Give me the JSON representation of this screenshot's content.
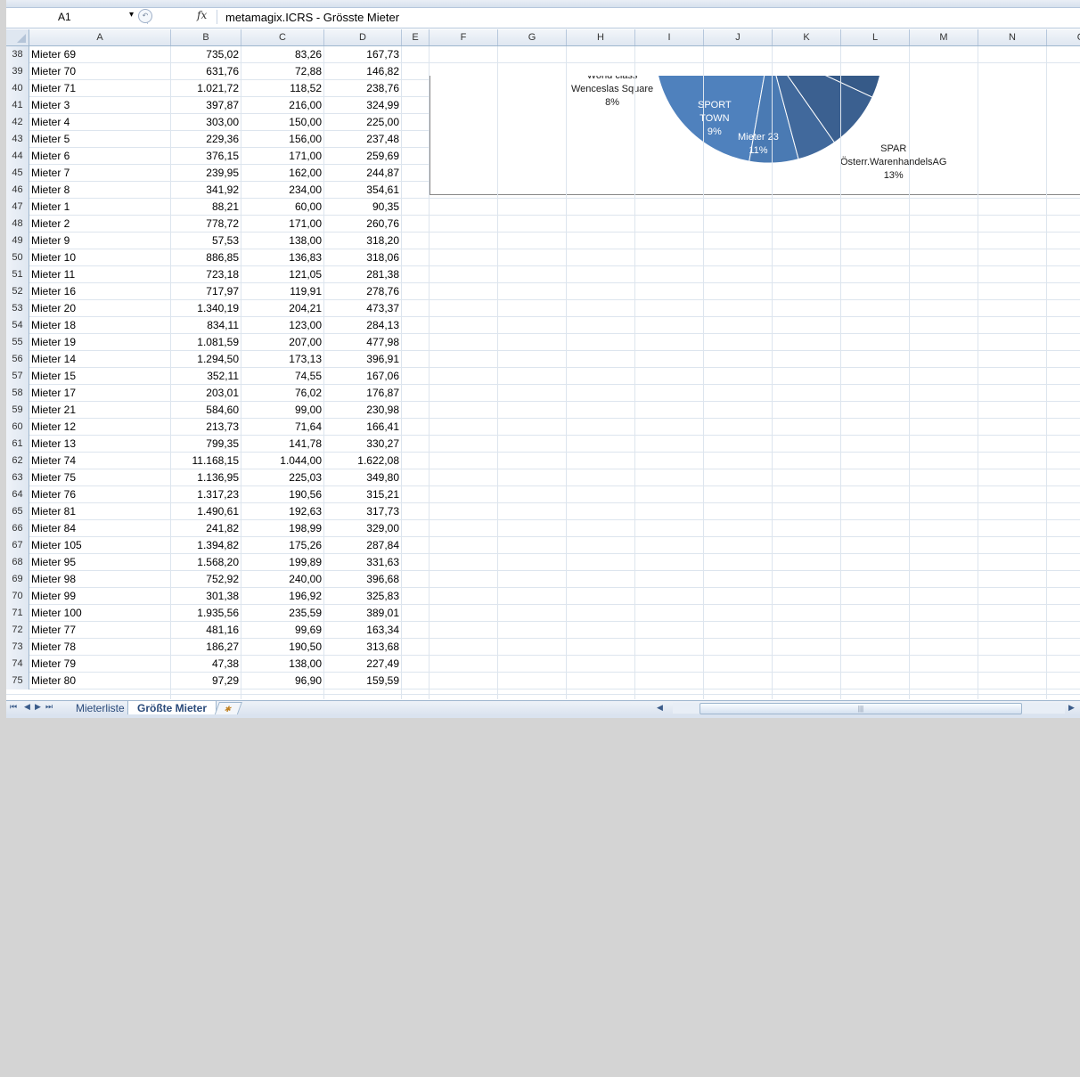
{
  "formula_bar": {
    "name_box": "A1",
    "fx_label": "fx",
    "formula": "metamagix.ICRS - Grösste Mieter"
  },
  "columns": [
    "A",
    "B",
    "C",
    "D",
    "E",
    "F",
    "G",
    "H",
    "I",
    "J",
    "K",
    "L",
    "M",
    "N",
    "O"
  ],
  "rows": [
    {
      "num": "38",
      "a": "Mieter 69",
      "b": "735,02",
      "c": "83,26",
      "d": "167,73"
    },
    {
      "num": "39",
      "a": "Mieter 70",
      "b": "631,76",
      "c": "72,88",
      "d": "146,82"
    },
    {
      "num": "40",
      "a": "Mieter 71",
      "b": "1.021,72",
      "c": "118,52",
      "d": "238,76"
    },
    {
      "num": "41",
      "a": "Mieter 3",
      "b": "397,87",
      "c": "216,00",
      "d": "324,99"
    },
    {
      "num": "42",
      "a": "Mieter 4",
      "b": "303,00",
      "c": "150,00",
      "d": "225,00"
    },
    {
      "num": "43",
      "a": "Mieter 5",
      "b": "229,36",
      "c": "156,00",
      "d": "237,48"
    },
    {
      "num": "44",
      "a": "Mieter 6",
      "b": "376,15",
      "c": "171,00",
      "d": "259,69"
    },
    {
      "num": "45",
      "a": "Mieter 7",
      "b": "239,95",
      "c": "162,00",
      "d": "244,87"
    },
    {
      "num": "46",
      "a": "Mieter 8",
      "b": "341,92",
      "c": "234,00",
      "d": "354,61"
    },
    {
      "num": "47",
      "a": "Mieter 1",
      "b": "88,21",
      "c": "60,00",
      "d": "90,35"
    },
    {
      "num": "48",
      "a": "Mieter 2",
      "b": "778,72",
      "c": "171,00",
      "d": "260,76"
    },
    {
      "num": "49",
      "a": "Mieter 9",
      "b": "57,53",
      "c": "138,00",
      "d": "318,20"
    },
    {
      "num": "50",
      "a": "Mieter 10",
      "b": "886,85",
      "c": "136,83",
      "d": "318,06"
    },
    {
      "num": "51",
      "a": "Mieter 11",
      "b": "723,18",
      "c": "121,05",
      "d": "281,38"
    },
    {
      "num": "52",
      "a": "Mieter 16",
      "b": "717,97",
      "c": "119,91",
      "d": "278,76"
    },
    {
      "num": "53",
      "a": "Mieter 20",
      "b": "1.340,19",
      "c": "204,21",
      "d": "473,37"
    },
    {
      "num": "54",
      "a": "Mieter 18",
      "b": "834,11",
      "c": "123,00",
      "d": "284,13"
    },
    {
      "num": "55",
      "a": "Mieter 19",
      "b": "1.081,59",
      "c": "207,00",
      "d": "477,98"
    },
    {
      "num": "56",
      "a": "Mieter 14",
      "b": "1.294,50",
      "c": "173,13",
      "d": "396,91"
    },
    {
      "num": "57",
      "a": "Mieter 15",
      "b": "352,11",
      "c": "74,55",
      "d": "167,06"
    },
    {
      "num": "58",
      "a": "Mieter 17",
      "b": "203,01",
      "c": "76,02",
      "d": "176,87"
    },
    {
      "num": "59",
      "a": "Mieter 21",
      "b": "584,60",
      "c": "99,00",
      "d": "230,98"
    },
    {
      "num": "60",
      "a": "Mieter 12",
      "b": "213,73",
      "c": "71,64",
      "d": "166,41"
    },
    {
      "num": "61",
      "a": "Mieter 13",
      "b": "799,35",
      "c": "141,78",
      "d": "330,27"
    },
    {
      "num": "62",
      "a": "Mieter 74",
      "b": "11.168,15",
      "c": "1.044,00",
      "d": "1.622,08"
    },
    {
      "num": "63",
      "a": "Mieter 75",
      "b": "1.136,95",
      "c": "225,03",
      "d": "349,80"
    },
    {
      "num": "64",
      "a": "Mieter 76",
      "b": "1.317,23",
      "c": "190,56",
      "d": "315,21"
    },
    {
      "num": "65",
      "a": "Mieter 81",
      "b": "1.490,61",
      "c": "192,63",
      "d": "317,73"
    },
    {
      "num": "66",
      "a": "Mieter 84",
      "b": "241,82",
      "c": "198,99",
      "d": "329,00"
    },
    {
      "num": "67",
      "a": "Mieter 105",
      "b": "1.394,82",
      "c": "175,26",
      "d": "287,84"
    },
    {
      "num": "68",
      "a": "Mieter 95",
      "b": "1.568,20",
      "c": "199,89",
      "d": "331,63"
    },
    {
      "num": "69",
      "a": "Mieter 98",
      "b": "752,92",
      "c": "240,00",
      "d": "396,68"
    },
    {
      "num": "70",
      "a": "Mieter 99",
      "b": "301,38",
      "c": "196,92",
      "d": "325,83"
    },
    {
      "num": "71",
      "a": "Mieter 100",
      "b": "1.935,56",
      "c": "235,59",
      "d": "389,01"
    },
    {
      "num": "72",
      "a": "Mieter 77",
      "b": "481,16",
      "c": "99,69",
      "d": "163,34"
    },
    {
      "num": "73",
      "a": "Mieter 78",
      "b": "186,27",
      "c": "190,50",
      "d": "313,68"
    },
    {
      "num": "74",
      "a": "Mieter 79",
      "b": "47,38",
      "c": "138,00",
      "d": "227,49"
    },
    {
      "num": "75",
      "a": "Mieter 80",
      "b": "97,29",
      "c": "96,90",
      "d": "159,59"
    }
  ],
  "chart_data": {
    "type": "pie",
    "slices": [
      {
        "label_lines": [
          "World class",
          "Wenceslas Square"
        ],
        "percent": "8%"
      },
      {
        "label_lines": [
          "SPORT",
          "TOWN"
        ],
        "percent": "9%"
      },
      {
        "label_lines": [
          "Mieter 23"
        ],
        "percent": "11%"
      },
      {
        "label_lines": [
          "SPAR",
          "Österr.WarenhandelsAG"
        ],
        "percent": "13%"
      }
    ],
    "colors": [
      "#4f81bd",
      "#4a7ab3",
      "#41699c",
      "#3b6090",
      "#365a88"
    ]
  },
  "sheet_tabs": [
    {
      "label": "Mieterliste",
      "active": false
    },
    {
      "label": "Größte Mieter",
      "active": true
    }
  ],
  "icons": {
    "first_sheet": "⏮",
    "prev_sheet": "◀",
    "next_sheet": "▶",
    "last_sheet": "⏭",
    "insert_sheet": "✱",
    "scroll_grip": "|||"
  }
}
